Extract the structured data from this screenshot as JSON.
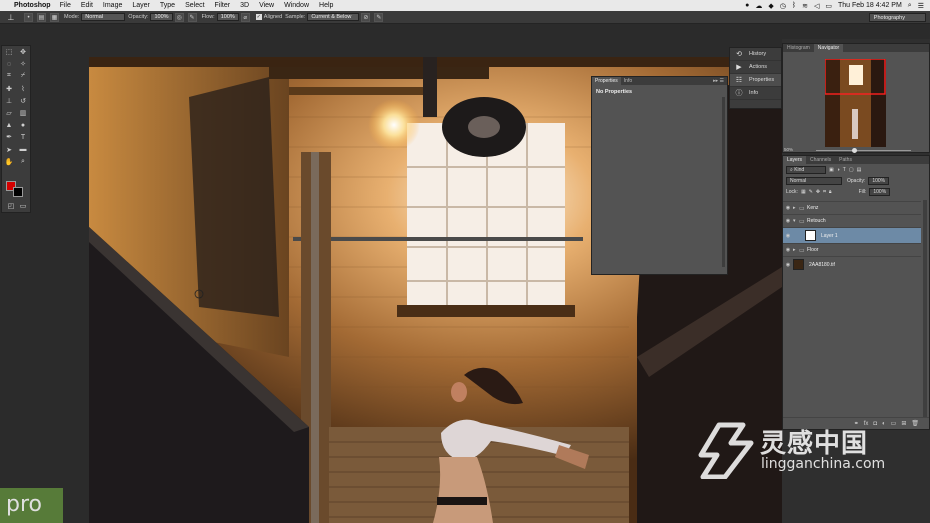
{
  "menubar": {
    "app_name": "Photoshop",
    "items": [
      "File",
      "Edit",
      "Image",
      "Layer",
      "Type",
      "Select",
      "Filter",
      "3D",
      "View",
      "Window",
      "Help"
    ],
    "clock": "Thu Feb 18  4:42 PM"
  },
  "options_bar": {
    "mode_label": "Mode:",
    "mode_value": "Normal",
    "opacity_label": "Opacity:",
    "opacity_value": "100%",
    "flow_label": "Flow:",
    "flow_value": "100%",
    "aligned_label": "Aligned",
    "sample_label": "Sample:",
    "sample_value": "Current & Below",
    "workspace": "Photography"
  },
  "properties_panel": {
    "tabs": [
      "Properties",
      "Info"
    ],
    "message": "No Properties"
  },
  "icon_column": {
    "items": [
      {
        "label": "History",
        "icon": "history-icon"
      },
      {
        "label": "Actions",
        "icon": "actions-icon"
      },
      {
        "label": "Properties",
        "icon": "properties-icon"
      },
      {
        "label": "Info",
        "icon": "info-icon"
      }
    ]
  },
  "navigator_panel": {
    "tabs": [
      "Histogram",
      "Navigator"
    ],
    "zoom": "50%"
  },
  "layers_panel": {
    "tabs": [
      "Layers",
      "Channels",
      "Paths"
    ],
    "filter": "Kind",
    "blend_mode": "Normal",
    "opacity_label": "Opacity:",
    "opacity_value": "100%",
    "lock_label": "Lock:",
    "fill_label": "Fill:",
    "fill_value": "100%",
    "layers": [
      {
        "name": "Kenz",
        "type": "group",
        "expanded": false
      },
      {
        "name": "Retouch",
        "type": "group",
        "expanded": true
      },
      {
        "name": "Layer 1",
        "type": "layer",
        "selected": true
      },
      {
        "name": "Floor",
        "type": "group",
        "expanded": false
      },
      {
        "name": "2AA8180.tif",
        "type": "image"
      }
    ]
  },
  "watermark": {
    "chinese": "灵感中国",
    "url": "lingganchina.com",
    "badge": "pro"
  },
  "colors": {
    "foreground": "#d40000",
    "background": "#000000",
    "selected_layer": "#6d8aa6"
  }
}
